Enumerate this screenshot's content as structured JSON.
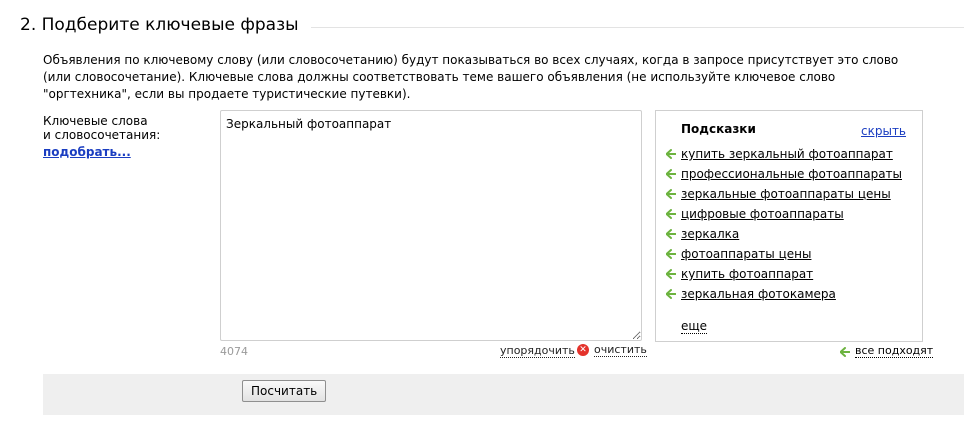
{
  "section": {
    "title": "2. Подберите ключевые фразы",
    "description": "Объявления по ключевому слову (или словосочетанию) будут показываться во всех случаях, когда в запросе присутствует это слово (или словосочетание). Ключевые слова должны соответствовать теме вашего объявления (не используйте ключевое слово \"оргтехника\", если вы продаете туристические путевки)."
  },
  "keywords": {
    "label_line1": "Ключевые слова",
    "label_line2": "и словосочетания:",
    "pick_link": "подобрать...",
    "value": "Зеркальный фотоаппарат",
    "counter": "4074",
    "sort_link": "упорядочить",
    "clear_link": "очистить"
  },
  "hints": {
    "title": "Подсказки",
    "hide_link": "скрыть",
    "items": [
      "купить зеркальный фотоаппарат",
      "профессиональные фотоаппараты",
      "зеркальные фотоаппараты цены",
      "цифровые фотоаппараты",
      "зеркалка",
      "фотоаппараты цены",
      "купить фотоаппарат",
      "зеркальная фотокамера"
    ],
    "more_link": "еще",
    "all_fit_link": "все подходят"
  },
  "footer": {
    "calculate_button": "Посчитать"
  },
  "colors": {
    "link_blue": "#1a3dc1",
    "arrow_green": "#6cb33f",
    "clear_red": "#e4322b",
    "footer_bg": "#efefef"
  }
}
